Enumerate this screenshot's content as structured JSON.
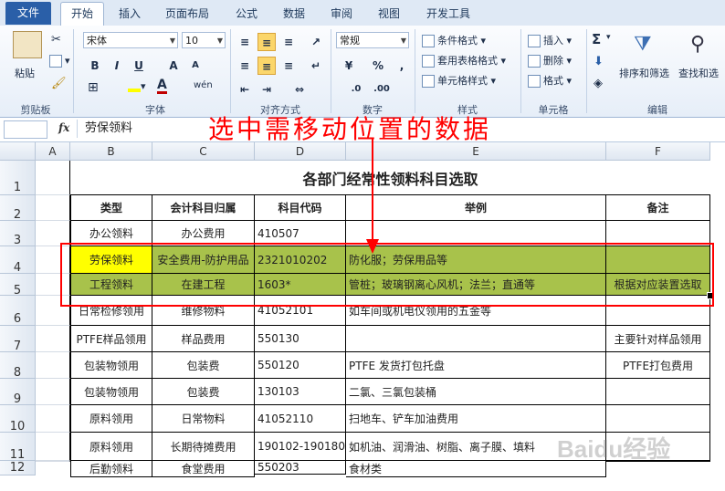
{
  "ribbon": {
    "tabs": [
      "文件",
      "开始",
      "插入",
      "页面布局",
      "公式",
      "数据",
      "审阅",
      "视图",
      "开发工具"
    ],
    "groups": {
      "clipboard": {
        "label": "剪贴板",
        "paste": "粘贴"
      },
      "font": {
        "label": "字体",
        "font_name": "宋体",
        "font_size": "10",
        "bold": "B",
        "italic": "I",
        "underline": "U",
        "grow": "A",
        "shrink": "A",
        "font_color": "A",
        "phonetic": "wén"
      },
      "align": {
        "label": "对齐方式"
      },
      "number": {
        "label": "数字",
        "format": "常规",
        "percent": "%",
        "comma": ","
      },
      "styles": {
        "label": "样式",
        "cond": "条件格式",
        "table": "套用表格格式",
        "cell": "单元格样式"
      },
      "cells": {
        "label": "单元格",
        "insert": "插入",
        "delete": "删除",
        "format": "格式"
      },
      "edit": {
        "label": "编辑",
        "sum": "Σ",
        "sort": "排序和筛选",
        "find": "查找和选"
      }
    }
  },
  "formula_bar": {
    "fx": "fx",
    "value": "劳保领料"
  },
  "annotation": "选中需移动位置的数据",
  "watermark": "Baidu经验",
  "columns": [
    "A",
    "B",
    "C",
    "D",
    "E",
    "F"
  ],
  "rows": [
    "1",
    "2",
    "3",
    "4",
    "5",
    "6",
    "7",
    "8",
    "9",
    "10",
    "11",
    "12"
  ],
  "sheet": {
    "title": "各部门经常性领料科目选取",
    "headers": [
      "类型",
      "会计科目归属",
      "科目代码",
      "举例",
      "备注"
    ],
    "data": [
      [
        "办公领料",
        "办公费用",
        "410507",
        "",
        ""
      ],
      [
        "劳保领料",
        "安全费用-防护用品",
        "2321010202",
        "防化服；劳保用品等",
        ""
      ],
      [
        "工程领料",
        "在建工程",
        "1603*",
        "管桩；玻璃钢离心风机；法兰；直通等",
        "根据对应装置选取"
      ],
      [
        "日常检修领用",
        "维修物料",
        "41052101",
        "如车间或机电仪领用的五金等",
        ""
      ],
      [
        "PTFE样品领用",
        "样品费用",
        "550130",
        "",
        "主要针对样品领用"
      ],
      [
        "包装物领用",
        "包装费",
        "550120",
        "PTFE 发货打包托盘",
        "PTFE打包费用"
      ],
      [
        "包装物领用",
        "包装费",
        "130103",
        "二氯、三氯包装桶",
        ""
      ],
      [
        "原料领用",
        "日常物料",
        "41052110",
        "扫地车、铲车加油费用",
        ""
      ],
      [
        "原料领用",
        "长期待摊费用",
        "190102-190180",
        "如机油、润滑油、树脂、离子膜、填料",
        ""
      ],
      [
        "后勤领料",
        "食堂费用",
        "550203",
        "食材类",
        ""
      ]
    ]
  },
  "colors": {
    "highlight": "#a8c24b",
    "selected": "#ffff00",
    "annotation": "#ff0000",
    "file_tab": "#2a5fa8"
  }
}
